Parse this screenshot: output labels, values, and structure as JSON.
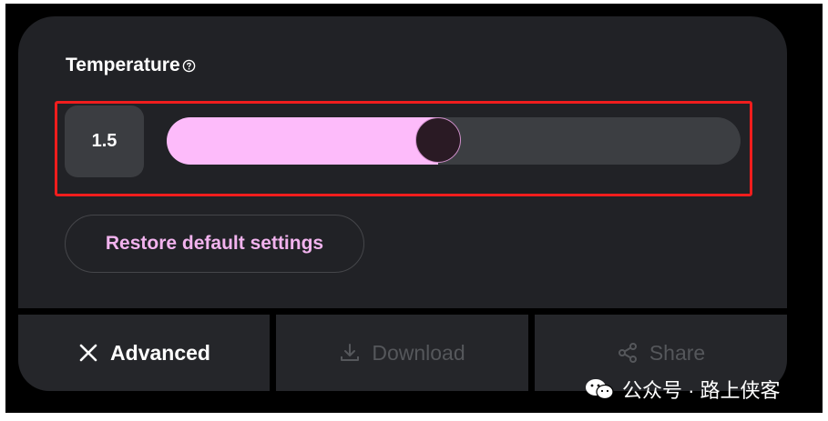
{
  "temperature": {
    "label": "Temperature",
    "help_icon": "help-circle-icon",
    "value": "1.5",
    "slider_fraction": 0.5
  },
  "restore_button": {
    "label": "Restore default settings"
  },
  "bottom_bar": {
    "advanced": {
      "label": "Advanced",
      "icon": "close-icon"
    },
    "download": {
      "label": "Download",
      "icon": "download-icon"
    },
    "share": {
      "label": "Share",
      "icon": "share-icon"
    }
  },
  "watermark": {
    "text": "公众号 · 路上侠客",
    "icon": "wechat-icon"
  },
  "colors": {
    "slider_fill": "#fdbbfa",
    "restore_text": "#f2b3ee",
    "highlight_border": "#f01d1d"
  }
}
